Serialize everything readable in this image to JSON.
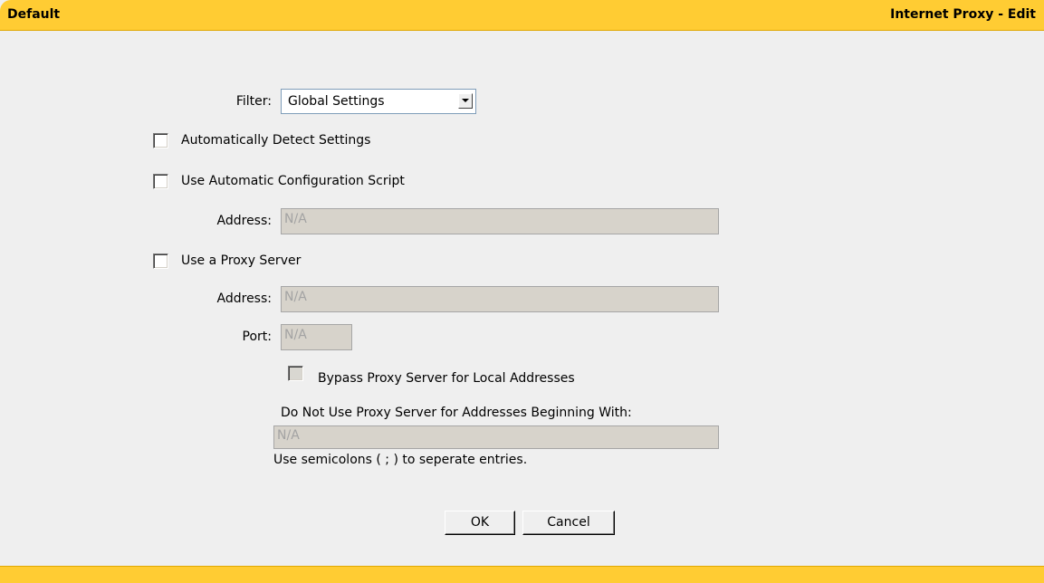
{
  "header": {
    "left_title": "Default",
    "right_title": "Internet Proxy - Edit"
  },
  "form": {
    "filter_label": "Filter:",
    "filter_value": "Global Settings",
    "auto_detect_label": "Automatically Detect Settings",
    "auto_config_label": "Use Automatic Configuration Script",
    "auto_config_address_label": "Address:",
    "auto_config_address_value": "N/A",
    "proxy_server_label": "Use a Proxy Server",
    "proxy_address_label": "Address:",
    "proxy_address_value": "N/A",
    "port_label": "Port:",
    "port_value": "N/A",
    "bypass_label": "Bypass Proxy Server for Local Addresses",
    "exceptions_label": "Do Not Use Proxy Server for Addresses Beginning With:",
    "exceptions_value": "N/A",
    "exceptions_hint": "Use semicolons ( ; ) to seperate entries."
  },
  "buttons": {
    "ok": "OK",
    "cancel": "Cancel"
  },
  "colors": {
    "header_bar": "#ffcc33",
    "background": "#efefef",
    "disabled_field": "#d7d3cb"
  },
  "icons": {
    "dropdown": "chevron-down-icon"
  }
}
